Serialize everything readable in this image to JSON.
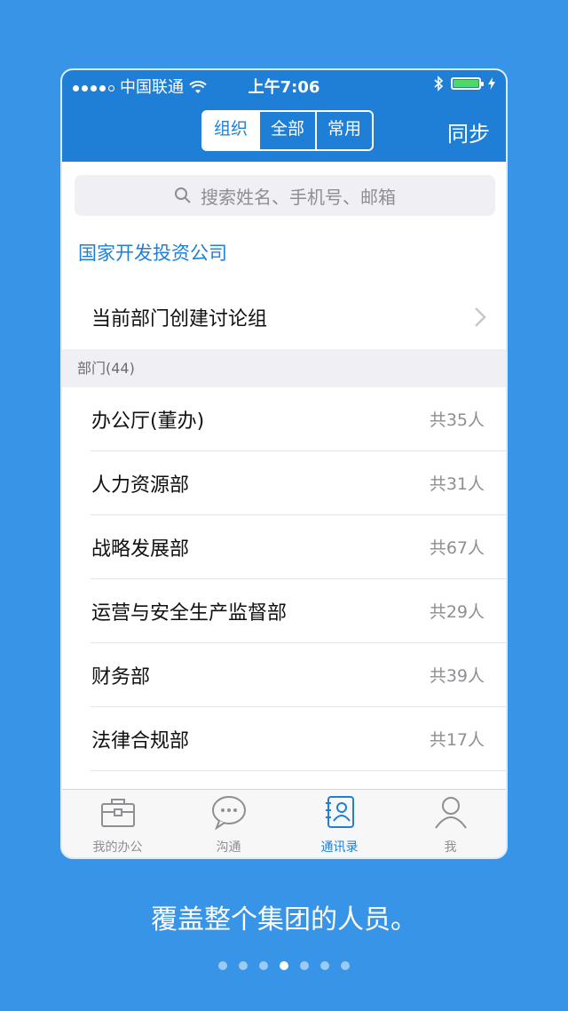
{
  "status_bar": {
    "carrier": "中国联通",
    "time": "上午7:06"
  },
  "header": {
    "tabs": [
      {
        "label": "组织",
        "active": true
      },
      {
        "label": "全部",
        "active": false
      },
      {
        "label": "常用",
        "active": false
      }
    ],
    "sync_label": "同步"
  },
  "search": {
    "placeholder": "搜索姓名、手机号、邮箱"
  },
  "company_name": "国家开发投资公司",
  "create_group_label": "当前部门创建讨论组",
  "section_header": "部门(44)",
  "departments": [
    {
      "name": "办公厅(董办)",
      "count": "共35人"
    },
    {
      "name": "人力资源部",
      "count": "共31人"
    },
    {
      "name": "战略发展部",
      "count": "共67人"
    },
    {
      "name": "运营与安全生产监督部",
      "count": "共29人"
    },
    {
      "name": "财务部",
      "count": "共39人"
    },
    {
      "name": "法律合规部",
      "count": "共17人"
    }
  ],
  "tabbar": [
    {
      "label": "我的办公",
      "icon": "briefcase-icon",
      "active": false
    },
    {
      "label": "沟通",
      "icon": "chat-bubble-icon",
      "active": false
    },
    {
      "label": "通讯录",
      "icon": "contacts-book-icon",
      "active": true
    },
    {
      "label": "我",
      "icon": "person-icon",
      "active": false
    }
  ],
  "caption": "覆盖整个集团的人员。",
  "pager": {
    "total": 7,
    "current": 4
  },
  "colors": {
    "background": "#3894e6",
    "primary": "#1f7fd6",
    "battery": "#4cd964"
  }
}
